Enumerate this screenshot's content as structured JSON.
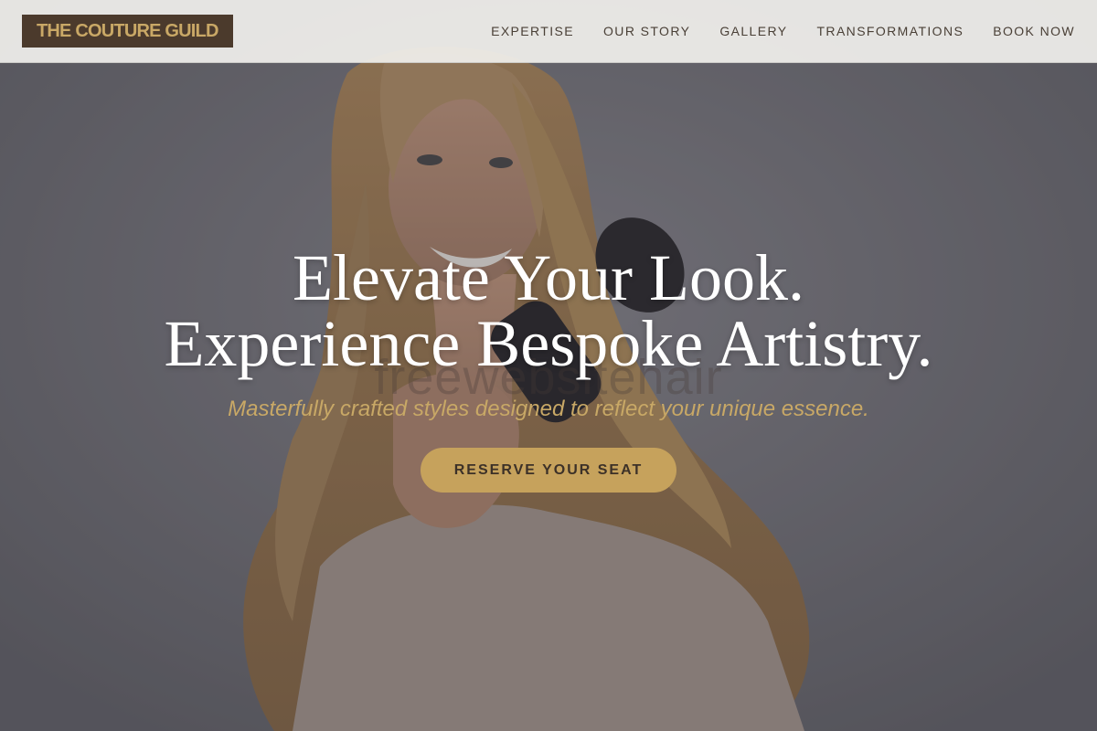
{
  "header": {
    "logo_text": "THE COUTURE GUILD",
    "nav": [
      {
        "label": "EXPERTISE"
      },
      {
        "label": "OUR STORY"
      },
      {
        "label": "GALLERY"
      },
      {
        "label": "TRANSFORMATIONS"
      },
      {
        "label": "BOOK NOW"
      }
    ]
  },
  "hero": {
    "title_line1": "Elevate Your Look.",
    "title_line2": "Experience Bespoke Artistry.",
    "subtitle": "Masterfully crafted styles designed to reflect your unique essence.",
    "cta_label": "RESERVE YOUR SEAT",
    "watermark": "freewebsitehair"
  },
  "colors": {
    "brand_dark": "#4b3a2c",
    "brand_gold": "#c6a25c",
    "subtitle_gold": "#c8a866",
    "nav_text": "#4a4037"
  }
}
